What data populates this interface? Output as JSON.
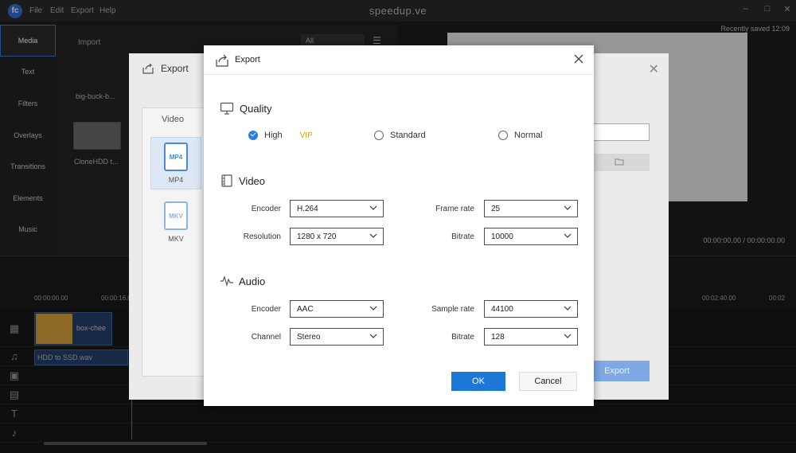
{
  "app": {
    "title": "speedup.ve",
    "menu": [
      "File",
      "Edit",
      "Export",
      "Help"
    ],
    "recently_saved": "Recently saved 12:09",
    "timecode": "00:00:00.00 / 00:00:00.00"
  },
  "sidebar": {
    "items": [
      {
        "label": "Media"
      },
      {
        "label": "Text"
      },
      {
        "label": "Filters"
      },
      {
        "label": "Overlays"
      },
      {
        "label": "Transitions"
      },
      {
        "label": "Elements"
      },
      {
        "label": "Music"
      }
    ]
  },
  "media": {
    "import_label": "Import",
    "filter_value": "All",
    "items": [
      {
        "label": "big-buck-b..."
      },
      {
        "label": "CloneHDD t..."
      }
    ]
  },
  "timeline": {
    "ruler": [
      "00:00:00.00",
      "00:00:16.0",
      "00:02:40.00",
      "00:02"
    ],
    "video_clip_label": "box-chee",
    "audio_clip_label": "HDD to SSD.wav"
  },
  "bg_dialog": {
    "title": "Export",
    "tab_video": "Video",
    "formats": [
      {
        "label": "MP4",
        "icon_text": "MP4"
      },
      {
        "label": "MKV",
        "icon_text": "MKV"
      }
    ],
    "export_label": "Export"
  },
  "dialog": {
    "title": "Export",
    "quality": {
      "title": "Quality",
      "options": [
        {
          "label": "High",
          "checked": true
        },
        {
          "label": "Standard",
          "checked": false
        },
        {
          "label": "Normal",
          "checked": false
        }
      ],
      "vip_label": "VIP"
    },
    "video": {
      "title": "Video",
      "encoder_label": "Encoder",
      "encoder_value": "H.264",
      "frame_rate_label": "Frame rate",
      "frame_rate_value": "25",
      "resolution_label": "Resolution",
      "resolution_value": "1280 x 720",
      "bitrate_label": "Bitrate",
      "bitrate_value": "10000"
    },
    "audio": {
      "title": "Audio",
      "encoder_label": "Encoder",
      "encoder_value": "AAC",
      "sample_rate_label": "Sample rate",
      "sample_rate_value": "44100",
      "channel_label": "Channel",
      "channel_value": "Stereo",
      "bitrate_label": "Bitrate",
      "bitrate_value": "128"
    },
    "ok_label": "OK",
    "cancel_label": "Cancel"
  },
  "colors": {
    "primary_button": "#1c78d6",
    "vip": "#d6a400",
    "radio_checked": "#2a7de1"
  }
}
